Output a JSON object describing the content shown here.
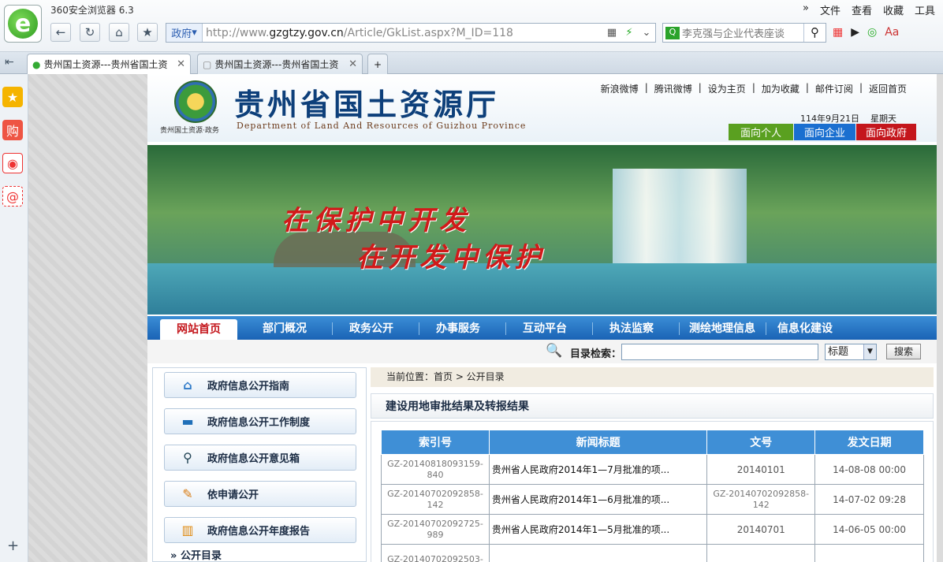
{
  "browser": {
    "app_title": "360安全浏览器 6.3",
    "menu": [
      "文件",
      "查看",
      "收藏",
      "工具"
    ],
    "url_tag": "政府",
    "url_prefix": "http://www.",
    "url_domain": "gzgtzy.gov.cn",
    "url_path": "/Article/GkList.aspx?M_ID=118",
    "search_text": "李克强与企业代表座谈",
    "tabs": [
      {
        "label": "贵州国土资源---贵州省国土资",
        "active": true
      },
      {
        "label": "贵州国土资源---贵州省国土资",
        "active": false
      }
    ]
  },
  "site": {
    "title": "贵州省国土资源厅",
    "subtitle": "Department of Land And Resources of Guizhou Province",
    "emblem_text": "贵州国土资源·政务",
    "top_links": [
      "新浪微博",
      "腾讯微博",
      "设为主页",
      "加为收藏",
      "邮件订阅",
      "返回首页"
    ],
    "date": "114年9月21日",
    "weekday": "星期天",
    "audience_buttons": [
      "面向个人",
      "面向企业",
      "面向政府"
    ],
    "slogan_1": "在保护中开发",
    "slogan_2": "在开发中保护",
    "nav": [
      "网站首页",
      "部门概况",
      "政务公开",
      "办事服务",
      "互动平台",
      "执法监察",
      "测绘地理信息",
      "信息化建设"
    ],
    "search_label": "目录检索：",
    "search_select": "标题",
    "search_button": "搜索"
  },
  "left_menu": {
    "items": [
      {
        "label": "政府信息公开指南",
        "icon": "house-icon"
      },
      {
        "label": "政府信息公开工作制度",
        "icon": "folder-icon"
      },
      {
        "label": "政府信息公开意见箱",
        "icon": "magnifier-icon"
      },
      {
        "label": "依申请公开",
        "icon": "pen-icon"
      },
      {
        "label": "政府信息公开年度报告",
        "icon": "bar-chart-icon"
      }
    ],
    "more": "公开目录"
  },
  "content": {
    "breadcrumb": "当前位置：首页 > 公开目录",
    "section_title": "建设用地审批结果及转报结果",
    "columns": [
      "索引号",
      "新闻标题",
      "文号",
      "发文日期"
    ],
    "rows": [
      {
        "index": "GZ-20140818093159-840",
        "title": "贵州省人民政府2014年1—7月批准的项...",
        "doc_no": "20140101",
        "date": "14-08-08 00:00"
      },
      {
        "index": "GZ-20140702092858-142",
        "title": "贵州省人民政府2014年1—6月批准的项...",
        "doc_no": "GZ-20140702092858-142",
        "date": "14-07-02 09:28"
      },
      {
        "index": "GZ-20140702092725-989",
        "title": "贵州省人民政府2014年1—5月批准的项...",
        "doc_no": "20140701",
        "date": "14-06-05 00:00"
      },
      {
        "index": "GZ-20140702092503-",
        "title": "",
        "doc_no": "",
        "date": ""
      }
    ]
  }
}
